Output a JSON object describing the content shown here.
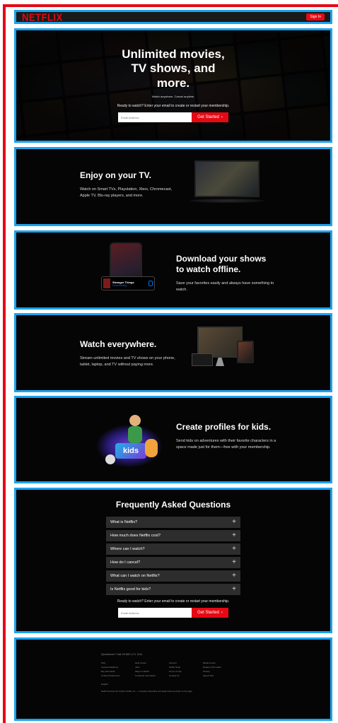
{
  "header": {
    "logo": "NETFLIX",
    "signin_label": "Sign In"
  },
  "hero": {
    "title": "Unlimited movies, TV shows, and more.",
    "subtitle": "Watch anywhere. Cancel anytime.",
    "cta_text": "Ready to watch? Enter your email to create or restart your membership.",
    "email_placeholder": "Email Address",
    "get_started_label": "Get Started",
    "arrow": "›"
  },
  "features": {
    "tv": {
      "title": "Enjoy on your TV.",
      "body": "Watch on Smart TVs, Playstation, Xbox, Chromecast, Apple TV, Blu-ray players, and more."
    },
    "download": {
      "title": "Download your shows to watch offline.",
      "body": "Save your favorites easily and always have something to watch.",
      "card_title": "Stranger Things",
      "card_status": "Downloading..."
    },
    "everywhere": {
      "title": "Watch everywhere.",
      "body": "Stream unlimited movies and TV shows on your phone, tablet, laptop, and TV without paying more."
    },
    "kids": {
      "title": "Create profiles for kids.",
      "body": "Send kids on adventures with their favorite characters in a space made just for them—free with your membership.",
      "logo_text": "kids"
    }
  },
  "faq": {
    "title": "Frequently Asked Questions",
    "items": [
      {
        "q": "What is Netflix?"
      },
      {
        "q": "How much does Netflix cost?"
      },
      {
        "q": "Where can I watch?"
      },
      {
        "q": "How do I cancel?"
      },
      {
        "q": "What can I watch on Netflix?"
      },
      {
        "q": "Is Netflix good for kids?"
      }
    ],
    "plus": "+",
    "cta_text": "Ready to watch? Enter your email to create or restart your membership.",
    "email_placeholder": "Email Address",
    "get_started_label": "Get Started",
    "arrow": "›"
  },
  "footer": {
    "question": "Questions? Call 00 800 171 1111",
    "links": [
      "FAQ",
      "Help Center",
      "Account",
      "Media Center",
      "Investor Relations",
      "Jobs",
      "Netflix Shop",
      "Redeem Gift Cards",
      "Buy Gift Cards",
      "Ways to Watch",
      "Terms of Use",
      "Privacy",
      "Cookie Preferences",
      "Corporate Information",
      "Contact Us",
      "Speed Test"
    ],
    "language": "English",
    "legal": "Netflix Services UK Limited. Netflix, Inc. — Company information and legal notice as shown on the page."
  },
  "colors": {
    "brand_red": "#e50914",
    "outline_blue": "#1aa3ee",
    "faq_bg": "#2d2d2d"
  }
}
